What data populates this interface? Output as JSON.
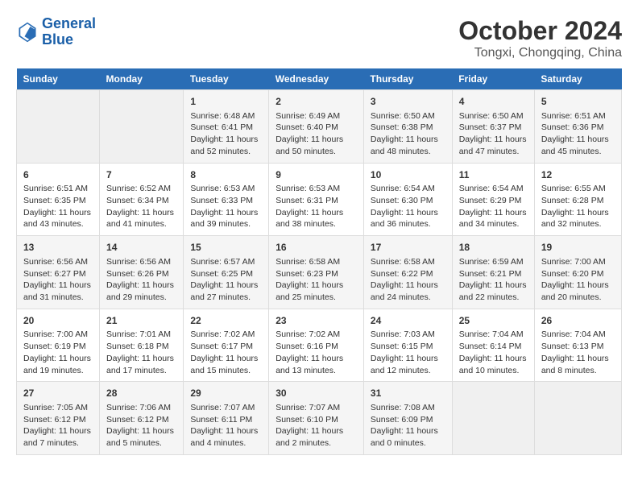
{
  "header": {
    "logo_line1": "General",
    "logo_line2": "Blue",
    "title": "October 2024",
    "subtitle": "Tongxi, Chongqing, China"
  },
  "days_of_week": [
    "Sunday",
    "Monday",
    "Tuesday",
    "Wednesday",
    "Thursday",
    "Friday",
    "Saturday"
  ],
  "weeks": [
    [
      {
        "day": "",
        "empty": true
      },
      {
        "day": "",
        "empty": true
      },
      {
        "day": "1",
        "sunrise": "Sunrise: 6:48 AM",
        "sunset": "Sunset: 6:41 PM",
        "daylight": "Daylight: 11 hours and 52 minutes."
      },
      {
        "day": "2",
        "sunrise": "Sunrise: 6:49 AM",
        "sunset": "Sunset: 6:40 PM",
        "daylight": "Daylight: 11 hours and 50 minutes."
      },
      {
        "day": "3",
        "sunrise": "Sunrise: 6:50 AM",
        "sunset": "Sunset: 6:38 PM",
        "daylight": "Daylight: 11 hours and 48 minutes."
      },
      {
        "day": "4",
        "sunrise": "Sunrise: 6:50 AM",
        "sunset": "Sunset: 6:37 PM",
        "daylight": "Daylight: 11 hours and 47 minutes."
      },
      {
        "day": "5",
        "sunrise": "Sunrise: 6:51 AM",
        "sunset": "Sunset: 6:36 PM",
        "daylight": "Daylight: 11 hours and 45 minutes."
      }
    ],
    [
      {
        "day": "6",
        "sunrise": "Sunrise: 6:51 AM",
        "sunset": "Sunset: 6:35 PM",
        "daylight": "Daylight: 11 hours and 43 minutes."
      },
      {
        "day": "7",
        "sunrise": "Sunrise: 6:52 AM",
        "sunset": "Sunset: 6:34 PM",
        "daylight": "Daylight: 11 hours and 41 minutes."
      },
      {
        "day": "8",
        "sunrise": "Sunrise: 6:53 AM",
        "sunset": "Sunset: 6:33 PM",
        "daylight": "Daylight: 11 hours and 39 minutes."
      },
      {
        "day": "9",
        "sunrise": "Sunrise: 6:53 AM",
        "sunset": "Sunset: 6:31 PM",
        "daylight": "Daylight: 11 hours and 38 minutes."
      },
      {
        "day": "10",
        "sunrise": "Sunrise: 6:54 AM",
        "sunset": "Sunset: 6:30 PM",
        "daylight": "Daylight: 11 hours and 36 minutes."
      },
      {
        "day": "11",
        "sunrise": "Sunrise: 6:54 AM",
        "sunset": "Sunset: 6:29 PM",
        "daylight": "Daylight: 11 hours and 34 minutes."
      },
      {
        "day": "12",
        "sunrise": "Sunrise: 6:55 AM",
        "sunset": "Sunset: 6:28 PM",
        "daylight": "Daylight: 11 hours and 32 minutes."
      }
    ],
    [
      {
        "day": "13",
        "sunrise": "Sunrise: 6:56 AM",
        "sunset": "Sunset: 6:27 PM",
        "daylight": "Daylight: 11 hours and 31 minutes."
      },
      {
        "day": "14",
        "sunrise": "Sunrise: 6:56 AM",
        "sunset": "Sunset: 6:26 PM",
        "daylight": "Daylight: 11 hours and 29 minutes."
      },
      {
        "day": "15",
        "sunrise": "Sunrise: 6:57 AM",
        "sunset": "Sunset: 6:25 PM",
        "daylight": "Daylight: 11 hours and 27 minutes."
      },
      {
        "day": "16",
        "sunrise": "Sunrise: 6:58 AM",
        "sunset": "Sunset: 6:23 PM",
        "daylight": "Daylight: 11 hours and 25 minutes."
      },
      {
        "day": "17",
        "sunrise": "Sunrise: 6:58 AM",
        "sunset": "Sunset: 6:22 PM",
        "daylight": "Daylight: 11 hours and 24 minutes."
      },
      {
        "day": "18",
        "sunrise": "Sunrise: 6:59 AM",
        "sunset": "Sunset: 6:21 PM",
        "daylight": "Daylight: 11 hours and 22 minutes."
      },
      {
        "day": "19",
        "sunrise": "Sunrise: 7:00 AM",
        "sunset": "Sunset: 6:20 PM",
        "daylight": "Daylight: 11 hours and 20 minutes."
      }
    ],
    [
      {
        "day": "20",
        "sunrise": "Sunrise: 7:00 AM",
        "sunset": "Sunset: 6:19 PM",
        "daylight": "Daylight: 11 hours and 19 minutes."
      },
      {
        "day": "21",
        "sunrise": "Sunrise: 7:01 AM",
        "sunset": "Sunset: 6:18 PM",
        "daylight": "Daylight: 11 hours and 17 minutes."
      },
      {
        "day": "22",
        "sunrise": "Sunrise: 7:02 AM",
        "sunset": "Sunset: 6:17 PM",
        "daylight": "Daylight: 11 hours and 15 minutes."
      },
      {
        "day": "23",
        "sunrise": "Sunrise: 7:02 AM",
        "sunset": "Sunset: 6:16 PM",
        "daylight": "Daylight: 11 hours and 13 minutes."
      },
      {
        "day": "24",
        "sunrise": "Sunrise: 7:03 AM",
        "sunset": "Sunset: 6:15 PM",
        "daylight": "Daylight: 11 hours and 12 minutes."
      },
      {
        "day": "25",
        "sunrise": "Sunrise: 7:04 AM",
        "sunset": "Sunset: 6:14 PM",
        "daylight": "Daylight: 11 hours and 10 minutes."
      },
      {
        "day": "26",
        "sunrise": "Sunrise: 7:04 AM",
        "sunset": "Sunset: 6:13 PM",
        "daylight": "Daylight: 11 hours and 8 minutes."
      }
    ],
    [
      {
        "day": "27",
        "sunrise": "Sunrise: 7:05 AM",
        "sunset": "Sunset: 6:12 PM",
        "daylight": "Daylight: 11 hours and 7 minutes."
      },
      {
        "day": "28",
        "sunrise": "Sunrise: 7:06 AM",
        "sunset": "Sunset: 6:12 PM",
        "daylight": "Daylight: 11 hours and 5 minutes."
      },
      {
        "day": "29",
        "sunrise": "Sunrise: 7:07 AM",
        "sunset": "Sunset: 6:11 PM",
        "daylight": "Daylight: 11 hours and 4 minutes."
      },
      {
        "day": "30",
        "sunrise": "Sunrise: 7:07 AM",
        "sunset": "Sunset: 6:10 PM",
        "daylight": "Daylight: 11 hours and 2 minutes."
      },
      {
        "day": "31",
        "sunrise": "Sunrise: 7:08 AM",
        "sunset": "Sunset: 6:09 PM",
        "daylight": "Daylight: 11 hours and 0 minutes."
      },
      {
        "day": "",
        "empty": true
      },
      {
        "day": "",
        "empty": true
      }
    ]
  ]
}
